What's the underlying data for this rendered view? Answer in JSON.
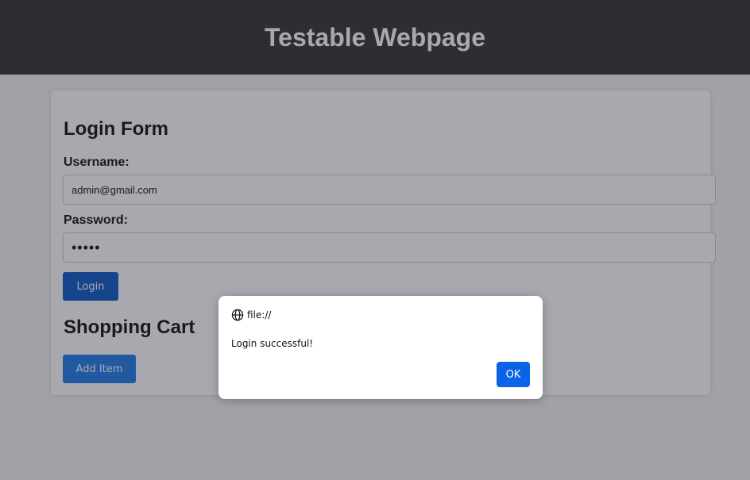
{
  "header": {
    "title": "Testable Webpage"
  },
  "login_form": {
    "title": "Login Form",
    "username_label": "Username:",
    "username_value": "admin@gmail.com",
    "password_label": "Password:",
    "password_value": "•••••",
    "login_button": "Login"
  },
  "shopping_cart": {
    "title": "Shopping Cart",
    "add_item_button": "Add Item"
  },
  "dialog": {
    "origin": "file://",
    "message": "Login successful!",
    "ok_button": "OK",
    "origin_icon": "globe-icon"
  },
  "colors": {
    "header_bg": "#333333",
    "primary_button": "#0a5bc4",
    "secondary_button": "#1e7de8",
    "dialog_ok": "#0b63e5"
  }
}
